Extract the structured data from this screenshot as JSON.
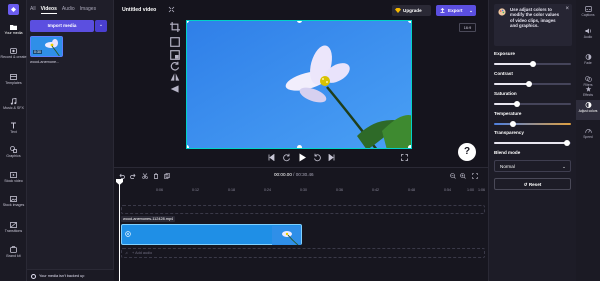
{
  "rail": {
    "items": [
      {
        "label": "Your media",
        "icon": "folder-icon"
      },
      {
        "label": "Record & create",
        "icon": "record-icon"
      },
      {
        "label": "Templates",
        "icon": "templates-icon"
      },
      {
        "label": "Music & SFX",
        "icon": "music-icon"
      },
      {
        "label": "Text",
        "icon": "text-icon"
      },
      {
        "label": "Graphics",
        "icon": "graphics-icon"
      },
      {
        "label": "Stock video",
        "icon": "stock-video-icon"
      },
      {
        "label": "Stock images",
        "icon": "stock-images-icon"
      },
      {
        "label": "Transitions",
        "icon": "transitions-icon"
      },
      {
        "label": "Brand kit",
        "icon": "brand-kit-icon"
      }
    ]
  },
  "media": {
    "tabs": [
      "All",
      "Videos",
      "Audio",
      "Images"
    ],
    "active_tab": "Videos",
    "import_label": "Import media",
    "thumb_duration": "0:30",
    "thumb_name": "wood-anemone...",
    "backup_text": "Your media isn't backed up"
  },
  "topbar": {
    "title": "Untitled video",
    "upgrade_label": "Upgrade",
    "export_label": "Export",
    "ratio_label": "16:9"
  },
  "playback": {
    "current": "00:00.00",
    "total": "/ 00:30.46"
  },
  "timeline": {
    "ticks": [
      "0:06",
      "0:12",
      "0:18",
      "0:24",
      "0:30",
      "0:36",
      "0:42",
      "0:48",
      "0:54",
      "1:00",
      "1:06"
    ],
    "clip_label": "wood-anemones-112428.mp4",
    "audio_placeholder": "+ Add audio"
  },
  "adjust": {
    "info_text": "Use adjust colors to modify the color values of video clips, images and graphics.",
    "sliders": [
      {
        "label": "Exposure",
        "value": 0.5
      },
      {
        "label": "Contrast",
        "value": 0.45
      },
      {
        "label": "Saturation",
        "value": 0.3
      },
      {
        "label": "Temperature",
        "value": 0.25
      },
      {
        "label": "Transparency",
        "value": 0.95
      }
    ],
    "blend_label": "Blend mode",
    "blend_value": "Normal",
    "reset_label": "Reset"
  },
  "prop_rail": {
    "items": [
      {
        "label": "Captions",
        "icon": "captions-icon"
      },
      {
        "label": "Audio",
        "icon": "audio-icon"
      },
      {
        "label": "Fade",
        "icon": "fade-icon"
      },
      {
        "label": "Filters",
        "icon": "filters-icon"
      },
      {
        "label": "Effects",
        "icon": "effects-icon"
      },
      {
        "label": "Adjust colors",
        "icon": "adjust-colors-icon"
      },
      {
        "label": "Speed",
        "icon": "speed-icon"
      }
    ]
  },
  "colors": {
    "accent": "#5b4fe0",
    "clip": "#1f8fe6",
    "preview_sky": "#3a8ef0",
    "selection": "#00d2c8"
  }
}
